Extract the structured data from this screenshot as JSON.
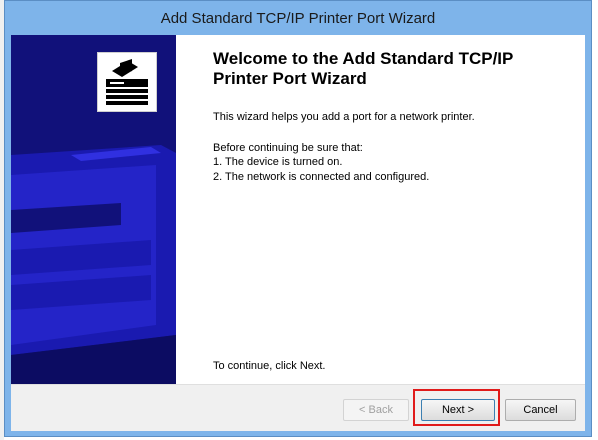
{
  "window": {
    "title": "Add Standard TCP/IP Printer Port Wizard"
  },
  "side_panel": {
    "logo_icon": "printer-wizard-icon",
    "colors": {
      "background": "#11117a",
      "graphic": "#2b2bd6"
    }
  },
  "content": {
    "heading": "Welcome to the Add Standard TCP/IP Printer Port Wizard",
    "intro": "This wizard helps you add a port for a network printer.",
    "before_continuing": "Before continuing be sure that:",
    "checklist": [
      "1.  The device is turned on.",
      "2.  The network is connected and configured."
    ],
    "continue_hint": "To continue, click Next."
  },
  "buttons": {
    "back": {
      "label": "< Back",
      "enabled": false
    },
    "next": {
      "label": "Next >",
      "enabled": true,
      "highlighted": true
    },
    "cancel": {
      "label": "Cancel",
      "enabled": true
    }
  },
  "colors": {
    "title_bar": "#7eb4ea",
    "highlight_box": "#e01b1b"
  }
}
